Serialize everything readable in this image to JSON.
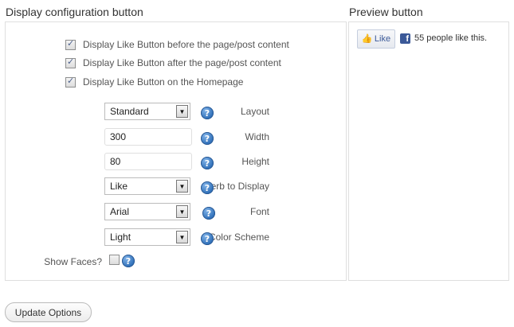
{
  "config": {
    "title": "Display configuration button",
    "checkboxes": [
      {
        "label": "Display Like Button before the page/post content",
        "checked": true
      },
      {
        "label": "Display Like Button after the page/post content",
        "checked": true
      },
      {
        "label": "Display Like Button on the Homepage",
        "checked": true
      }
    ],
    "fields": {
      "layout": {
        "label": "Layout",
        "value": "Standard"
      },
      "width": {
        "label": "Width",
        "value": "300"
      },
      "height": {
        "label": "Height",
        "value": "80"
      },
      "verb": {
        "label": "Verb to Display",
        "value": "Like"
      },
      "font": {
        "label": "Font",
        "value": "Arial"
      },
      "color_scheme": {
        "label": "Color Scheme",
        "value": "Light"
      },
      "show_faces": {
        "label": "Show Faces?",
        "checked": false
      }
    },
    "help_glyph": "?"
  },
  "preview": {
    "title": "Preview button",
    "like_button_label": "Like",
    "facebook_glyph": "f",
    "like_count_text": "55 people like this."
  },
  "actions": {
    "update_label": "Update Options"
  },
  "icons": [
    "checkbox-checked-icon",
    "dropdown-arrow-icon",
    "help-icon",
    "thumbs-up-icon",
    "facebook-icon"
  ],
  "colors": {
    "help_blue": "#2f6fb8",
    "facebook_blue": "#3b5998",
    "border": "#dfdfdf"
  }
}
